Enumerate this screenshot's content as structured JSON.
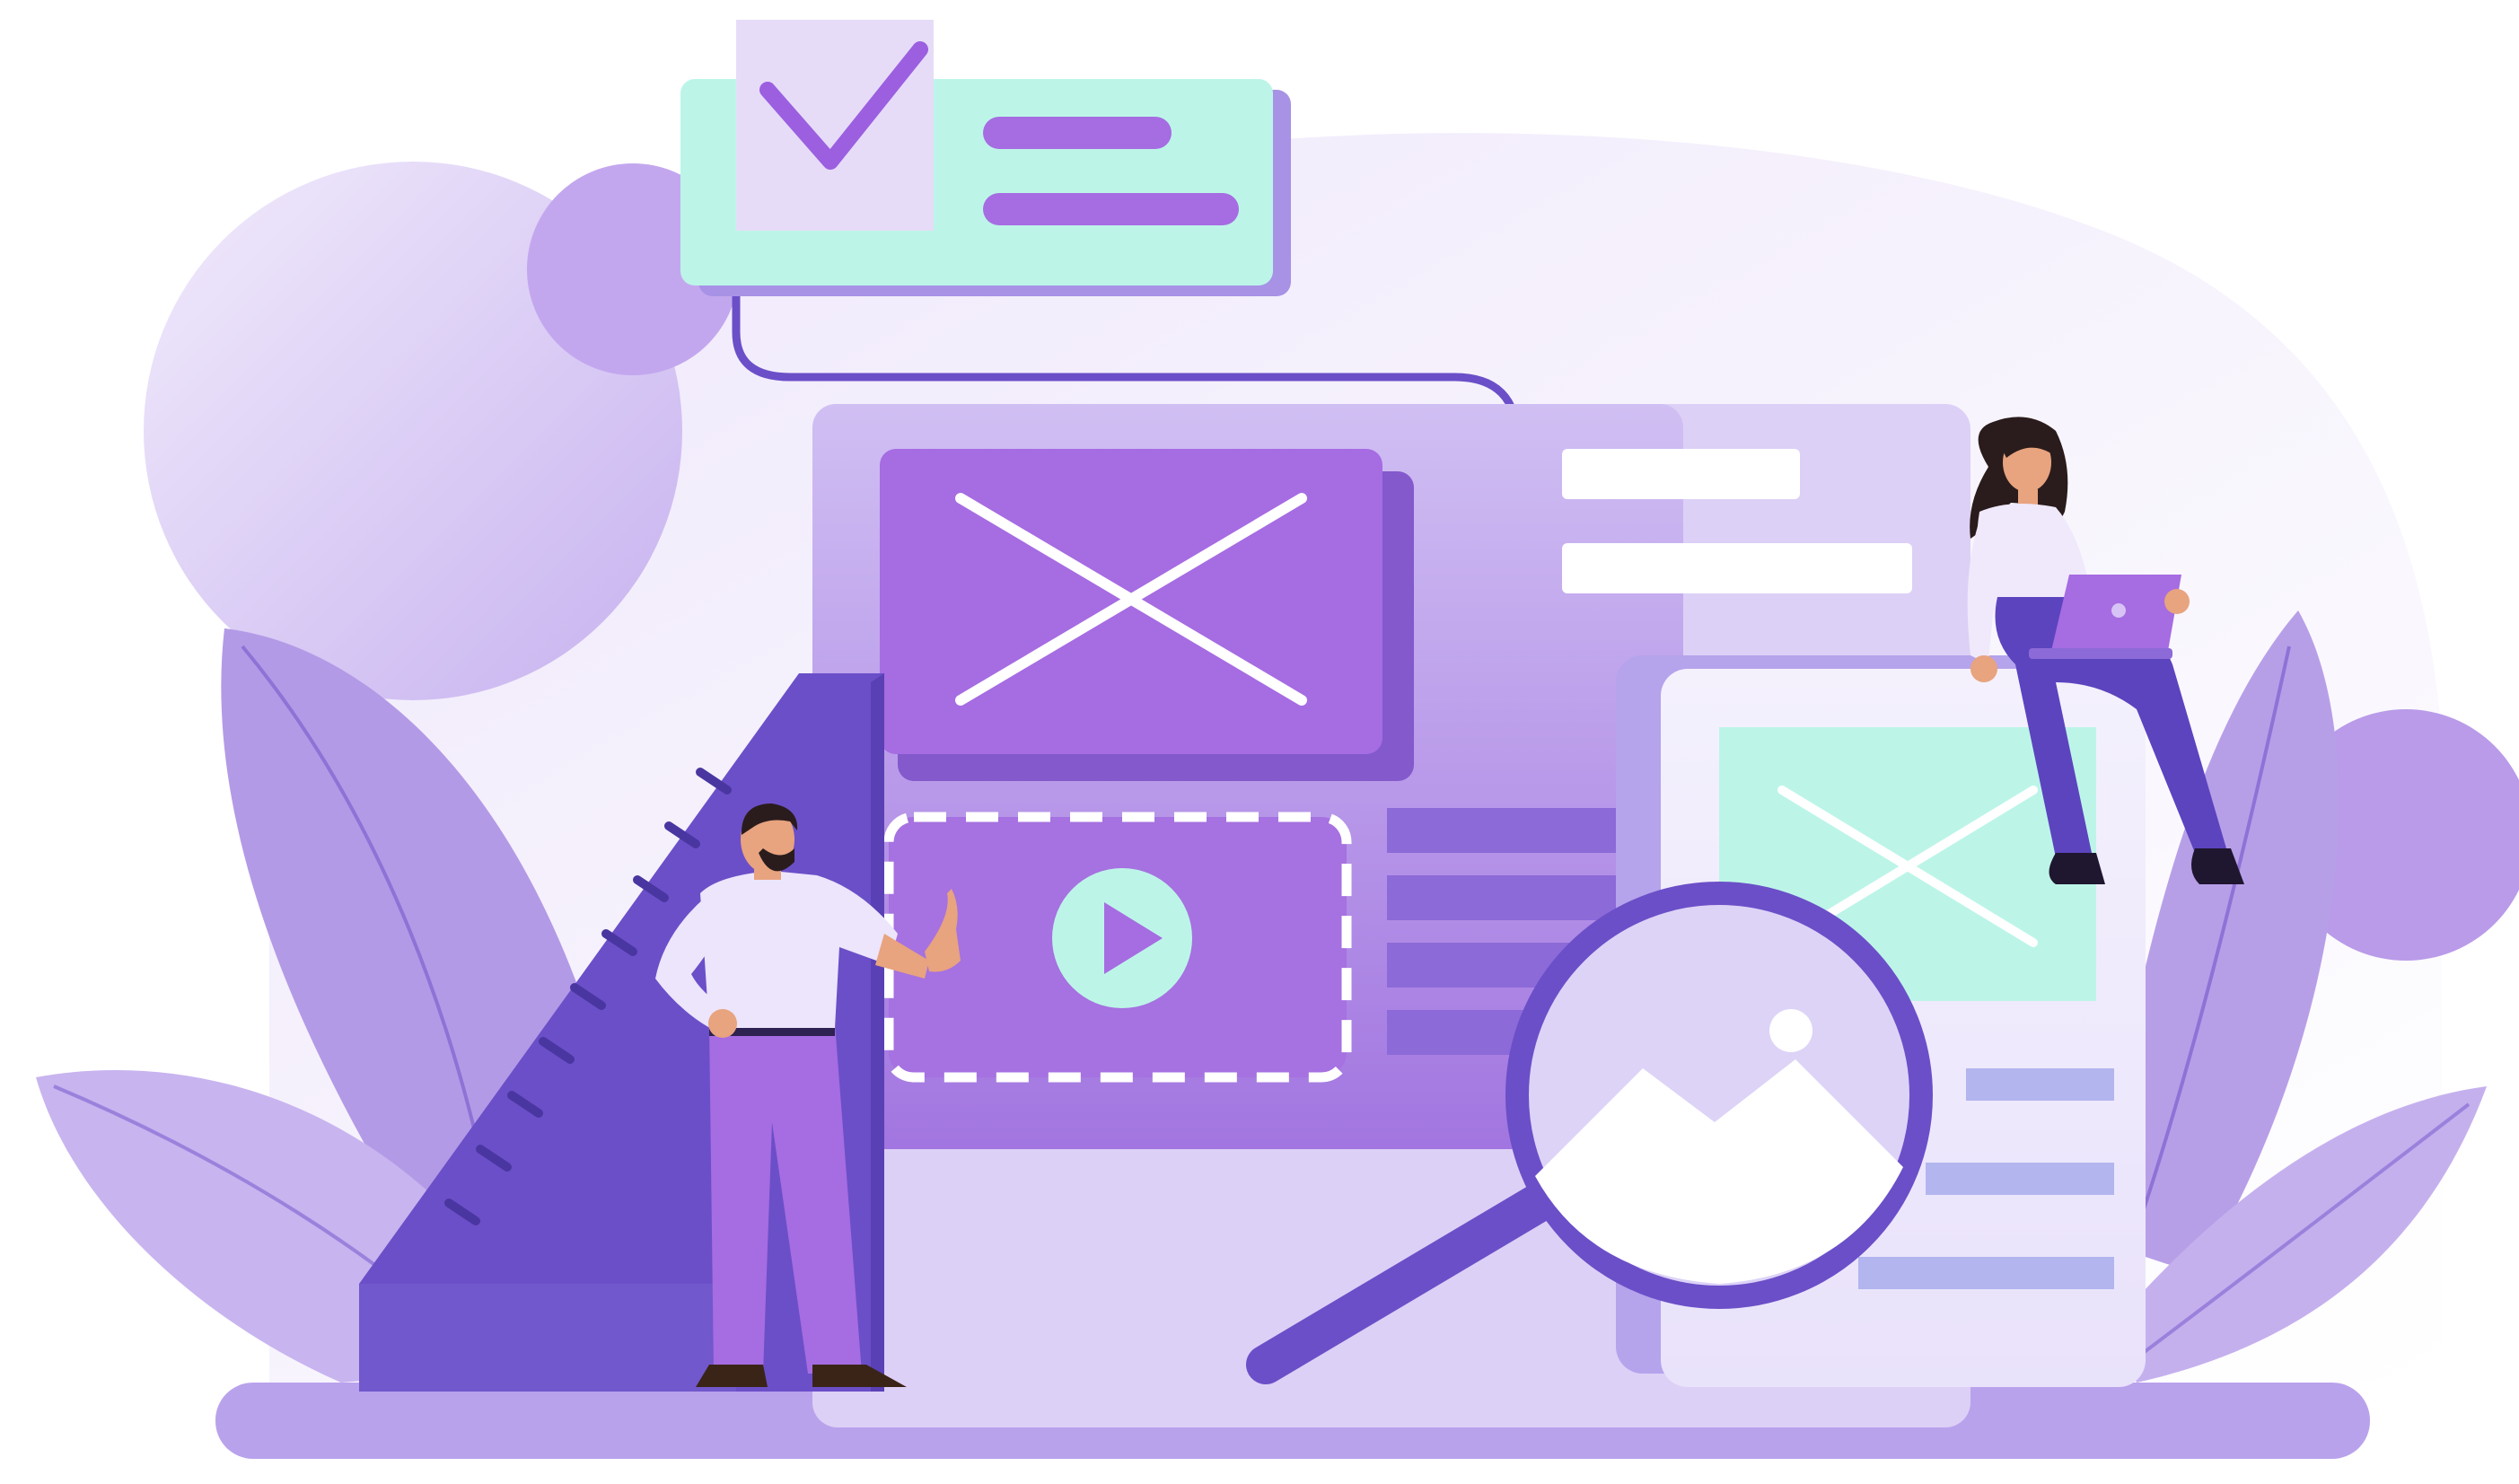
{
  "scene": {
    "subject": "wireframe-design-illustration"
  },
  "palette": {
    "purple_deep": "#6b4fc8",
    "purple_main": "#a66ce2",
    "purple_mid": "#c3a6ee",
    "purple_light": "#e2d6f7",
    "lavender_bg": "#d9cdf3",
    "mint": "#bcf5e8",
    "white": "#ffffff",
    "navy": "#4b3aa8",
    "skin": "#e8a37f",
    "hair": "#2a1c1c"
  },
  "icons": [
    "check-icon",
    "play-icon",
    "image-placeholder-icon",
    "magnifying-glass-icon",
    "ruler-icon",
    "laptop-icon"
  ]
}
